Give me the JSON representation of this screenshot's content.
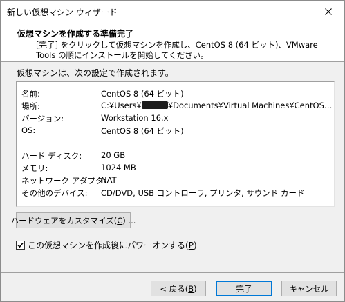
{
  "window": {
    "title": "新しい仮想マシン ウィザード"
  },
  "header": {
    "title": "仮想マシンを作成する準備完了",
    "description": "[完了] をクリックして仮想マシンを作成し、CentOS 8 (64 ビット)、VMware Tools の順にインストールを開始してください。"
  },
  "summary": {
    "intro": "仮想マシンは、次の設定で作成されます。",
    "rows": [
      {
        "label": "名前:",
        "value": "CentOS 8 (64 ビット)"
      },
      {
        "label": "場所:",
        "value_prefix": "C:¥Users¥",
        "value_suffix": "¥Documents¥Virtual Machines¥CentOS 8 (…"
      },
      {
        "label": "バージョン:",
        "value": "Workstation 16.x"
      },
      {
        "label": "OS:",
        "value": "CentOS 8 (64 ビット)"
      },
      {
        "label": "ハード ディスク:",
        "value": "20 GB"
      },
      {
        "label": "メモリ:",
        "value": "1024 MB"
      },
      {
        "label": "ネットワーク アダプタ:",
        "value": "NAT"
      },
      {
        "label": "その他のデバイス:",
        "value": "CD/DVD, USB コントローラ, プリンタ, サウンド カード"
      }
    ]
  },
  "customize_button": {
    "label_before": "ハードウェアをカスタマイズ(",
    "accel": "C",
    "label_after": ") ..."
  },
  "power_on": {
    "checked": true,
    "label_before": "この仮想マシンを作成後にパワーオンする(",
    "accel": "P",
    "label_after": ")"
  },
  "buttons": {
    "back": {
      "label_before": "< 戻る(",
      "accel": "B",
      "label_after": ")"
    },
    "finish": {
      "label": "完了"
    },
    "cancel": {
      "label": "キャンセル"
    }
  }
}
